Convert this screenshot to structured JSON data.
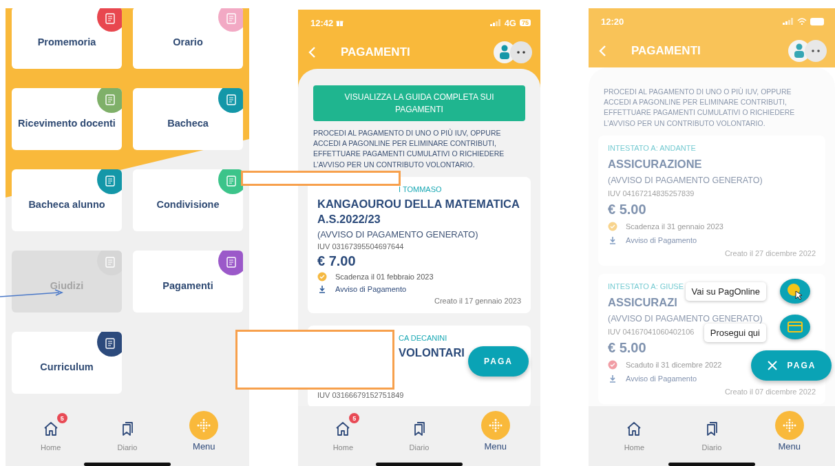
{
  "menu_screen": {
    "tiles": [
      {
        "label": "Promemoria",
        "color": "#e8474f",
        "disabled": false
      },
      {
        "label": "Orario",
        "color": "#f2a9c4",
        "disabled": false
      },
      {
        "label": "Ricevimento docenti",
        "color": "#7fb069",
        "disabled": false
      },
      {
        "label": "Bacheca",
        "color": "#1497a8",
        "disabled": false
      },
      {
        "label": "Bacheca alunno",
        "color": "#1497a8",
        "disabled": false
      },
      {
        "label": "Condivisione",
        "color": "#3cc48a",
        "disabled": false
      },
      {
        "label": "Giudizi",
        "color": "#d6d6d6",
        "disabled": true
      },
      {
        "label": "Pagamenti",
        "color": "#9b59c9",
        "disabled": false
      },
      {
        "label": "Curriculum",
        "color": "#2c4a7c",
        "disabled": false
      }
    ],
    "nav": [
      {
        "label": "Home",
        "badge": "5",
        "selected": false
      },
      {
        "label": "Diario",
        "selected": false
      },
      {
        "label": "Menu",
        "selected": true
      }
    ]
  },
  "payments_screen": {
    "status_bar": {
      "time": "12:42",
      "network": "4G",
      "battery": "75"
    },
    "title": "PAGAMENTI",
    "guide_button": "VISUALIZZA LA GUIDA COMPLETA SUI PAGAMENTI",
    "intro": "PROCEDI AL PAGAMENTO DI UNO O PIÙ IUV, OPPURE ACCEDI A PAGONLINE PER ELIMINARE CONTRIBUTI, EFFETTUARE PAGAMENTI CUMULATIVI O RICHIEDERE L’AVVISO PER UN CONTRIBUTO VOLONTARIO.",
    "cards": [
      {
        "holder": "I TOMMASO",
        "holder_covered": true,
        "title_covered": false,
        "title": "KANGAOUROU DELLA MATEMATICA A.S.2022/23",
        "subtitle": "(AVVISO DI PAGAMENTO GENERATO)",
        "iuv": "IUV 03167395504697644",
        "amount": "€ 7.00",
        "expired": false,
        "deadline": "Scadenza il 01 febbraio 2023",
        "notice": "Avviso di Pagamento",
        "created": "Creato il 17 gennaio 2023"
      },
      {
        "holder": "CA DECANINI",
        "holder_covered": true,
        "title_covered": true,
        "title": "VOLONTARI",
        "iuv": "IUV 03166679152751849"
      }
    ],
    "paga_button": {
      "label": "PAGA",
      "open": false
    },
    "nav": [
      {
        "label": "Home",
        "badge": "5",
        "selected": false
      },
      {
        "label": "Diario",
        "selected": false
      },
      {
        "label": "Menu",
        "selected": true
      }
    ]
  },
  "payments_screen_actions": {
    "dimmed": true,
    "status_bar": {
      "time": "12:20"
    },
    "title": "PAGAMENTI",
    "intro": "PROCEDI AL PAGAMENTO DI UNO O PIÙ IUV, OPPURE ACCEDI A PAGONLINE PER ELIMINARE CONTRIBUTI, EFFETTUARE PAGAMENTI CUMULATIVI O RICHIEDERE L’AVVISO PER UN CONTRIBUTO VOLONTARIO.",
    "cards": [
      {
        "holder": "INTESTATO A: ANDANTE",
        "holder_covered": false,
        "title_covered": false,
        "title": "ASSICURAZIONE",
        "subtitle": "(AVVISO DI PAGAMENTO GENERATO)",
        "iuv": "IUV 04167214835257839",
        "amount": "€ 5.00",
        "expired": false,
        "deadline": "Scadenza il 31 gennaio 2023",
        "notice": "Avviso di Pagamento",
        "created": "Creato il 27 dicembre 2022"
      },
      {
        "holder": "INTESTATO A: GIUSE",
        "holder_covered": false,
        "title_covered": false,
        "title": "ASSICURAZI",
        "subtitle": "(AVVISO DI PAGAMENTO GENERATO)",
        "iuv": "IUV 04167041060402106",
        "amount": "€ 5.00",
        "expired": true,
        "deadline": "Scaduto il 31 dicembre 2022",
        "notice": "Avviso di Pagamento",
        "created": "Creato il 07 dicembre 2022"
      }
    ],
    "actions": [
      {
        "label": "Vai su PagOnline",
        "kind": "pagonline"
      },
      {
        "label": "Prosegui qui",
        "kind": "card"
      }
    ],
    "paga_button": {
      "label": "PAGA",
      "open": true
    },
    "nav": [
      {
        "label": "Home",
        "selected": false
      },
      {
        "label": "Diario",
        "selected": false
      },
      {
        "label": "Menu",
        "selected": true
      }
    ]
  }
}
